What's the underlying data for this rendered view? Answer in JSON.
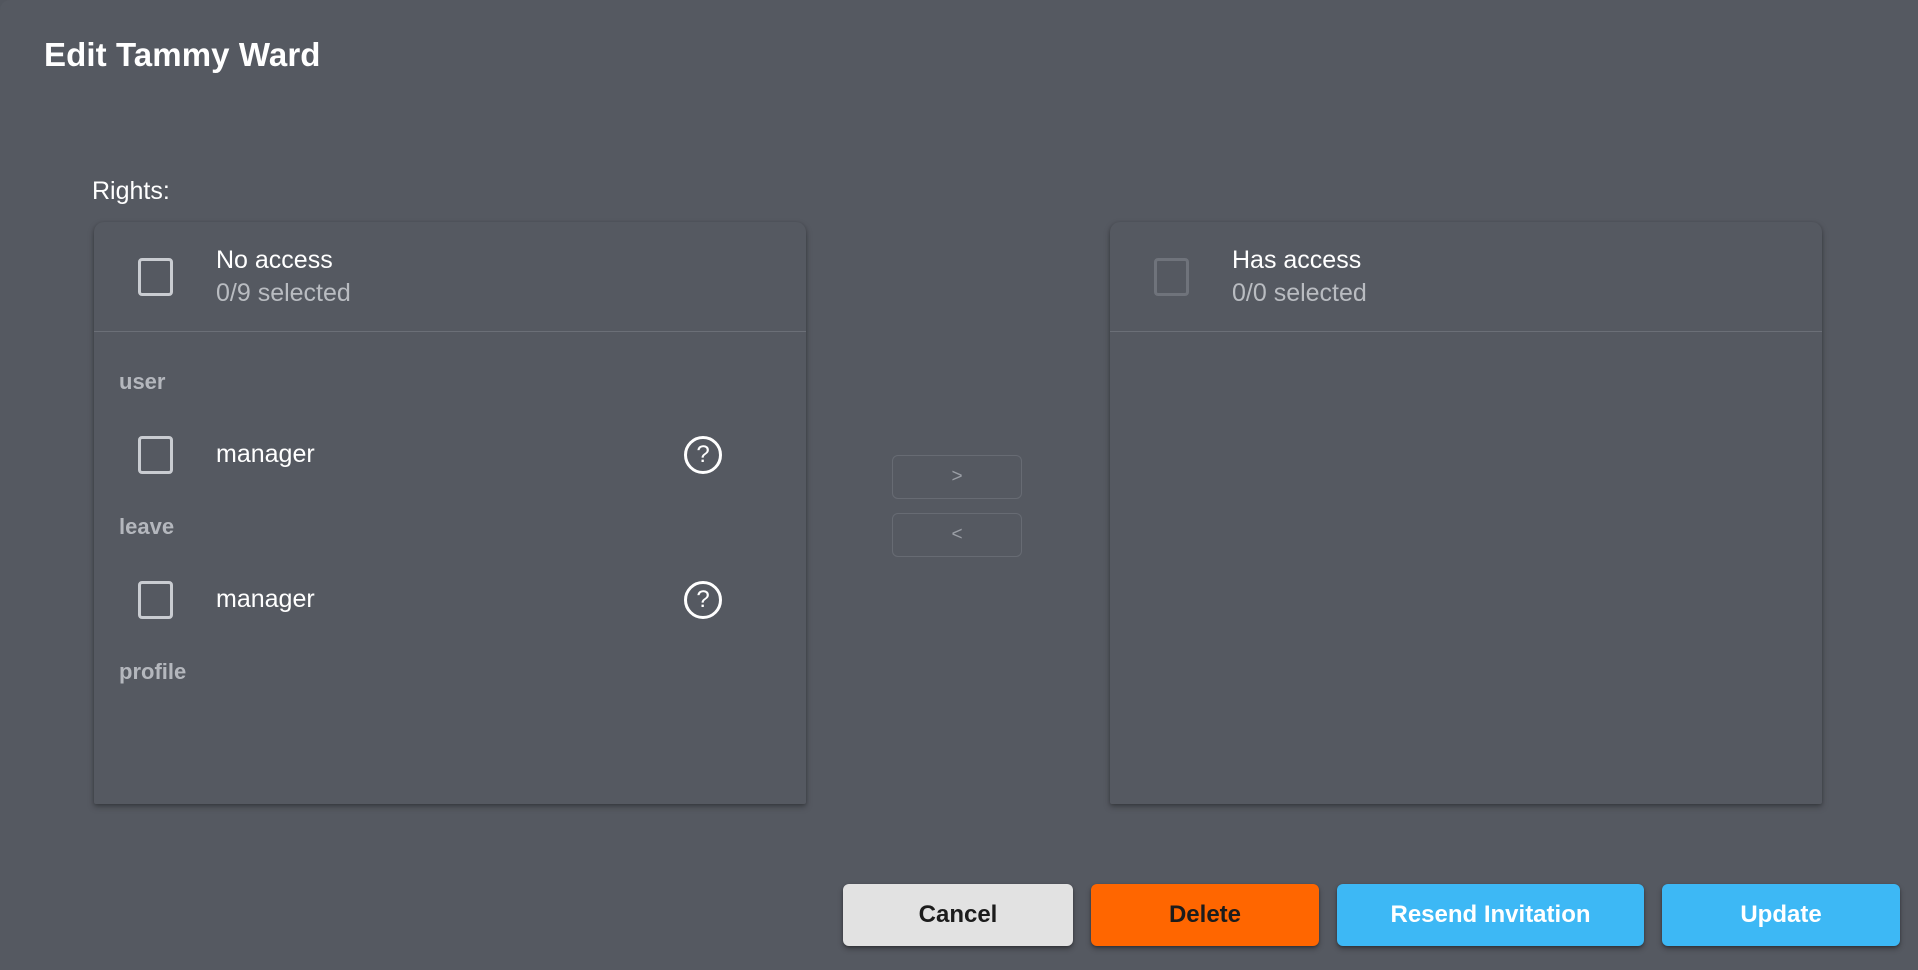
{
  "dialog": {
    "title": "Edit Tammy Ward",
    "rights_label": "Rights:"
  },
  "colors": {
    "background": "#555961",
    "panel": "#555961",
    "divider": "#6b6f77",
    "cancel": "#e2e2e2",
    "delete": "#ff6600",
    "primary_blue": "#3db8f5",
    "text_primary": "#ffffff",
    "text_secondary": "#b9bcc1",
    "group_label": "#b4b7bd",
    "checkbox_border": "#c9ccd1",
    "checkbox_border_dim": "#6f737b"
  },
  "no_access_panel": {
    "title": "No access",
    "selected_text": "0/9 selected",
    "checkbox_checked": false,
    "items": [
      {
        "type": "group",
        "label": "user"
      },
      {
        "type": "item",
        "label": "manager",
        "checked": false,
        "help_icon": "help-circle-icon"
      },
      {
        "type": "group",
        "label": "leave"
      },
      {
        "type": "item",
        "label": "manager",
        "checked": false,
        "help_icon": "help-circle-icon"
      },
      {
        "type": "group",
        "label": "profile"
      }
    ]
  },
  "has_access_panel": {
    "title": "Has access",
    "selected_text": "0/0 selected",
    "checkbox_checked": false,
    "items": []
  },
  "transfer": {
    "to_right_label": ">",
    "to_left_label": "<"
  },
  "footer": {
    "cancel_label": "Cancel",
    "delete_label": "Delete",
    "resend_label": "Resend Invitation",
    "update_label": "Update"
  }
}
